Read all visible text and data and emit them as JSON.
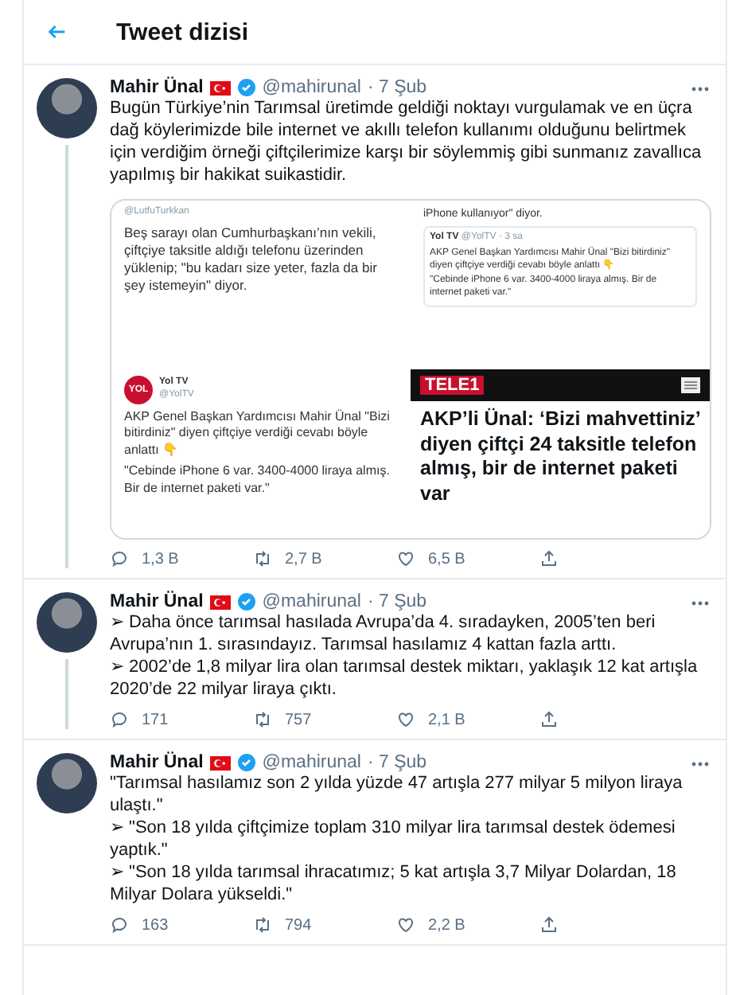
{
  "header": {
    "title": "Tweet dizisi"
  },
  "tweets": [
    {
      "name": "Mahir Ünal",
      "handle": "@mahirunal",
      "time": "· 7 Şub",
      "verified": true,
      "thread_continues": true,
      "text": [
        "Bugün Türkiye’nin Tarımsal üretimde geldiği noktayı vurgulamak ve en  üçra dağ köylerimizde bile internet ve akıllı telefon kullanımı olduğunu belirtmek için verdiğim örneği çiftçilerimize karşı bir söylemmiş gibi sunmanız zavallıca yapılmış bir hakikat suikastidir."
      ],
      "media": {
        "panels": [
          {
            "kind": "tweet-text",
            "handle": "@LutfuTurkkan",
            "text": "Beş sarayı olan Cumhurbaşkanı’nın vekili, çiftçiye taksitle aldığı telefonu üzerinden yüklenip; \"bu kadarı size yeter, fazla da bir şey istemeyin\" diyor."
          },
          {
            "kind": "quote",
            "top": "iPhone kullanıyor\" diyor.",
            "name": "Yol TV",
            "handle": "@YolTV · 3 sa",
            "text": "AKP Genel Başkan Yardımcısı Mahir Ünal \"Bizi bitirdiniz\" diyen çiftçiye verdiği cevabı böyle anlattı 👇",
            "quote": "\"Cebinde iPhone 6 var. 3400-4000 liraya almış. Bir de internet paketi var.\""
          },
          {
            "kind": "tweet",
            "logo": "YOL",
            "name": "Yol TV",
            "handle": "@YolTV",
            "text": "AKP Genel Başkan Yardımcısı Mahir Ünal \"Bizi bitirdiniz\" diyen çiftçiye verdiği cevabı böyle anlattı 👇",
            "quote": "\"Cebinde iPhone 6 var. 3400-4000 liraya almış. Bir de internet paketi var.\""
          },
          {
            "kind": "news",
            "logo": "TELE1",
            "headline": "AKP’li Ünal: ‘Bizi mahvettiniz’ diyen çiftçi 24 taksitle telefon almış, bir de internet paketi var"
          }
        ]
      },
      "replies": "1,3 B",
      "retweets": "2,7 B",
      "likes": "6,5 B"
    },
    {
      "name": "Mahir Ünal",
      "handle": "@mahirunal",
      "time": "· 7 Şub",
      "verified": true,
      "thread_continues": true,
      "text": [
        "➢ Daha önce tarımsal hasılada Avrupa’da 4. sıradayken, 2005’ten beri Avrupa’nın 1. sırasındayız. Tarımsal hasılamız 4 kattan fazla arttı.",
        "➢ 2002’de 1,8 milyar lira olan tarımsal destek miktarı, yaklaşık 12 kat artışla 2020’de 22 milyar liraya çıktı."
      ],
      "replies": "171",
      "retweets": "757",
      "likes": "2,1 B"
    },
    {
      "name": "Mahir Ünal",
      "handle": "@mahirunal",
      "time": "· 7 Şub",
      "verified": true,
      "thread_continues": false,
      "text": [
        "\"Tarımsal hasılamız son 2 yılda yüzde 47 artışla 277 milyar 5 milyon liraya ulaştı.\"",
        "➢ \"Son 18 yılda çiftçimize toplam 310 milyar lira tarımsal destek ödemesi yaptık.\"",
        "➢ \"Son 18 yılda tarımsal ihracatımız; 5 kat artışla 3,7 Milyar Dolardan, 18 Milyar Dolara yükseldi.\""
      ],
      "replies": "163",
      "retweets": "794",
      "likes": "2,2 B"
    }
  ]
}
